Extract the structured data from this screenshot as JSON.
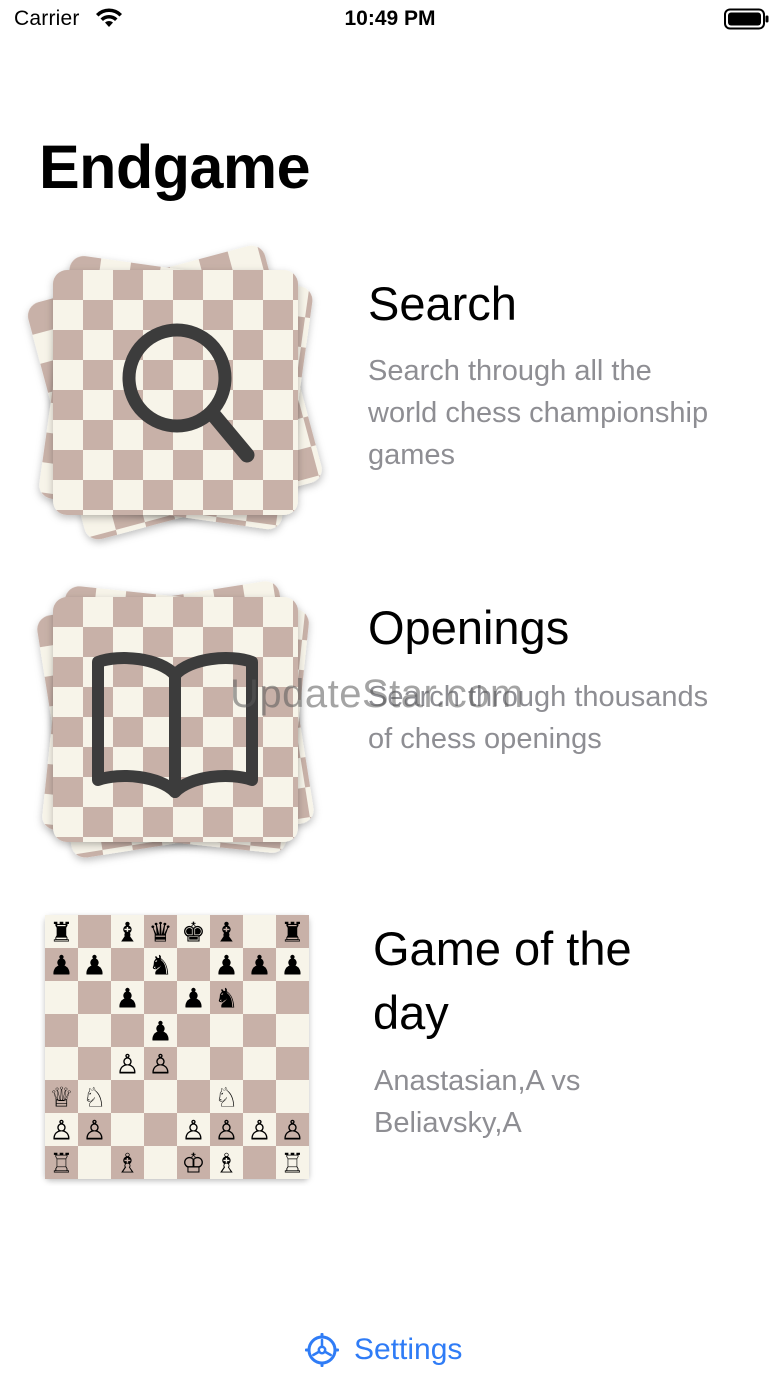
{
  "status": {
    "carrier": "Carrier",
    "time": "10:49 PM"
  },
  "page": {
    "title": "Endgame"
  },
  "colors": {
    "board_dark": "#c8b1a8",
    "board_light": "#f7f4e9",
    "accent": "#2f7cf6",
    "secondary_text": "#8e8e93"
  },
  "menu": [
    {
      "id": "search",
      "title": "Search",
      "description_lines": [
        "Search through all the",
        "world chess championship",
        "games"
      ],
      "icon": "magnifier-icon"
    },
    {
      "id": "openings",
      "title": "Openings",
      "description_lines": [
        "Search through thousands",
        "of chess openings"
      ],
      "icon": "book-icon"
    },
    {
      "id": "game-of-the-day",
      "title_lines": [
        "Game of the",
        "day"
      ],
      "description_lines": [
        "Anastasian,A vs",
        "Beliavsky,A"
      ],
      "board_fen": "r1bqkb1r/pp1n1ppp/2p1pn2/3p4/2PP4/QN3N2/PP2PPPP/R1B1KB1R"
    }
  ],
  "settings": {
    "label": "Settings",
    "icon": "gear-icon"
  },
  "watermark": "UpdateStar.com"
}
